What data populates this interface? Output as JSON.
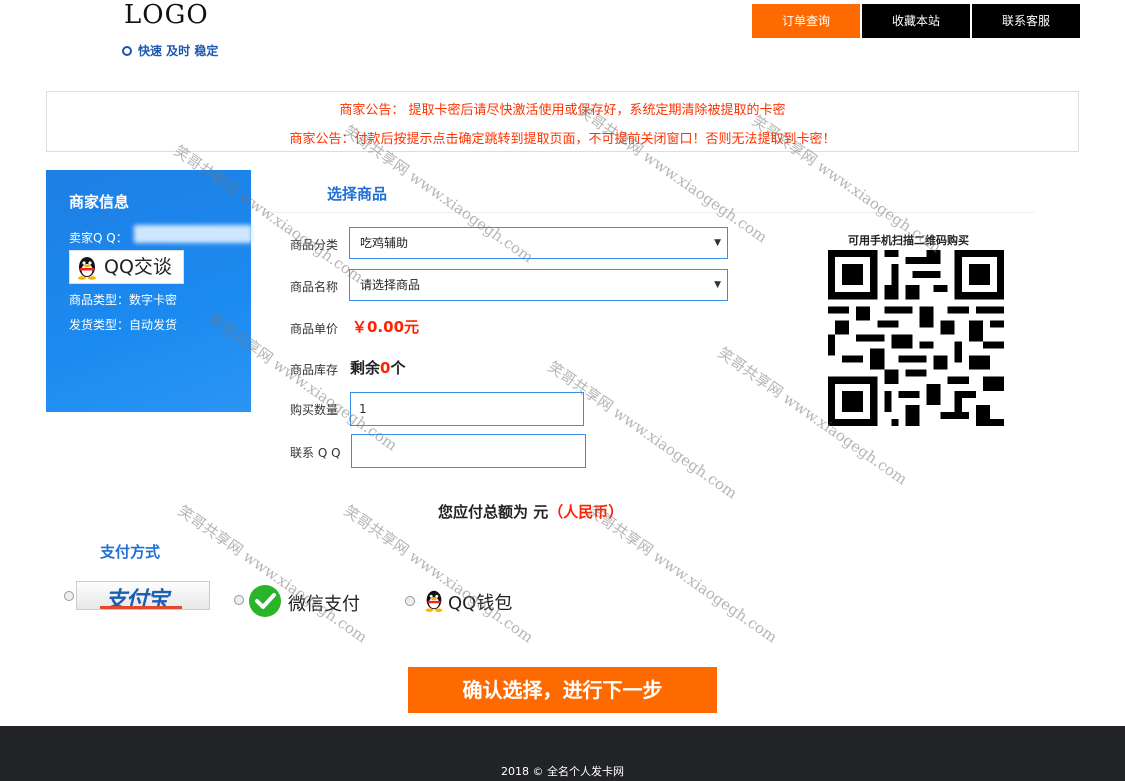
{
  "header": {
    "logo": "LOGO",
    "slogan": "快速 及时 稳定",
    "nav": [
      {
        "label": "订单查询",
        "active": true
      },
      {
        "label": "收藏本站",
        "active": false
      },
      {
        "label": "联系客服",
        "active": false
      }
    ]
  },
  "notice": {
    "line1": "商家公告： 提取卡密后请尽快激活使用或保存好，系统定期清除被提取的卡密",
    "line2": "商家公告：付款后按提示点击确定跳转到提取页面，不可提前关闭窗口！否则无法提取到卡密！"
  },
  "merchant": {
    "title": "商家信息",
    "qq_label": "卖家Q Q：",
    "qq_button": "QQ交谈",
    "product_type": "商品类型：数字卡密",
    "ship_type": "发货类型：自动发货"
  },
  "form": {
    "section_title": "选择商品",
    "category_label": "商品分类",
    "category_value": "吃鸡辅助",
    "product_label": "商品名称",
    "product_value": "请选择商品",
    "price_label": "商品单价",
    "price_value": "￥0.00元",
    "stock_label": "商品库存",
    "stock_prefix": "剩余",
    "stock_count": "0",
    "stock_suffix": "个",
    "qty_label": "购买数量",
    "qty_value": "1",
    "contact_label": "联系 Q Q",
    "contact_value": ""
  },
  "qr": {
    "caption": "可用手机扫描二维码购买"
  },
  "total": {
    "prefix": "您应付总额为 元",
    "currency": "（人民币）"
  },
  "payment": {
    "title": "支付方式",
    "options": [
      {
        "label": "支付宝"
      },
      {
        "label": "微信支付"
      },
      {
        "label": "QQ钱包"
      }
    ]
  },
  "confirm_button": "确认选择，进行下一步",
  "footer": "2018 © 全名个人发卡网",
  "watermark": "笑哥共享网 www.xiaogegh.com",
  "colors": {
    "accent": "#ff6a00",
    "primary": "#1e7fe4",
    "notice": "#ff3300"
  }
}
